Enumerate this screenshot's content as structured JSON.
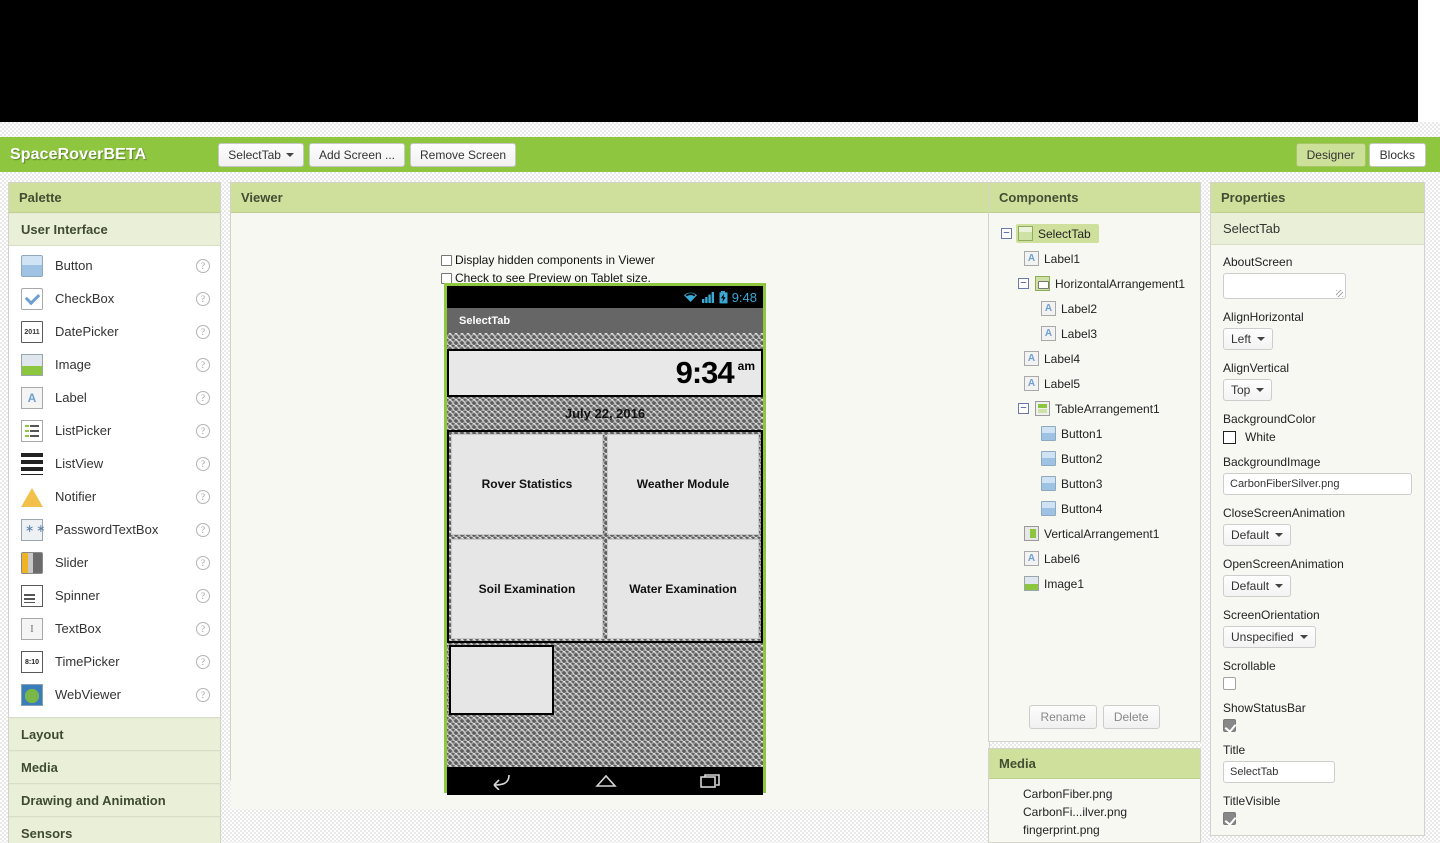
{
  "header": {
    "project_title": "SpaceRoverBETA",
    "buttons": [
      {
        "label": "SelectTab",
        "has_caret": true
      },
      {
        "label": "Add Screen ...",
        "has_caret": false
      },
      {
        "label": "Remove Screen",
        "has_caret": false
      }
    ],
    "designer_tab": "Designer",
    "blocks_tab": "Blocks"
  },
  "palette": {
    "title": "Palette",
    "groups": [
      {
        "name": "User Interface",
        "expanded": true,
        "items": [
          {
            "label": "Button",
            "icon": "button-icon"
          },
          {
            "label": "CheckBox",
            "icon": "checkbox-icon"
          },
          {
            "label": "DatePicker",
            "icon": "datepicker-icon"
          },
          {
            "label": "Image",
            "icon": "image-icon"
          },
          {
            "label": "Label",
            "icon": "label-icon"
          },
          {
            "label": "ListPicker",
            "icon": "listpicker-icon"
          },
          {
            "label": "ListView",
            "icon": "listview-icon"
          },
          {
            "label": "Notifier",
            "icon": "notifier-icon"
          },
          {
            "label": "PasswordTextBox",
            "icon": "password-icon"
          },
          {
            "label": "Slider",
            "icon": "slider-icon"
          },
          {
            "label": "Spinner",
            "icon": "spinner-icon"
          },
          {
            "label": "TextBox",
            "icon": "textbox-icon"
          },
          {
            "label": "TimePicker",
            "icon": "timepicker-icon"
          },
          {
            "label": "WebViewer",
            "icon": "webviewer-icon"
          }
        ]
      },
      {
        "name": "Layout",
        "expanded": false,
        "items": []
      },
      {
        "name": "Media",
        "expanded": false,
        "items": []
      },
      {
        "name": "Drawing and Animation",
        "expanded": false,
        "items": []
      },
      {
        "name": "Sensors",
        "expanded": false,
        "items": []
      }
    ],
    "help_glyph": "?",
    "icon_text": {
      "datepicker": "2011",
      "label": "A",
      "textbox": "I",
      "timepicker": "8:10"
    }
  },
  "viewer": {
    "title": "Viewer",
    "checkbox_hidden_components": "Display hidden components in Viewer",
    "checkbox_tablet_preview": "Check to see Preview on Tablet size.",
    "phone": {
      "status_time": "9:48",
      "title_bar": "SelectTab",
      "clock_time": "9:34",
      "clock_ampm": "am",
      "date_label": "July 22, 2016",
      "buttons": [
        "Rover Statistics",
        "Weather Module",
        "Soil Examination",
        "Water Examination"
      ],
      "nav_icons": [
        "back-icon",
        "home-icon",
        "recents-icon"
      ]
    }
  },
  "components": {
    "title": "Components",
    "tree": [
      {
        "label": "SelectTab",
        "depth": 0,
        "icon": "screen-icon",
        "toggle": "minus",
        "selected": true
      },
      {
        "label": "Label1",
        "depth": 1,
        "icon": "label-icon",
        "toggle": "none",
        "selected": false
      },
      {
        "label": "HorizontalArrangement1",
        "depth": 1,
        "icon": "horizontal-arrangement-icon",
        "toggle": "minus",
        "selected": false
      },
      {
        "label": "Label2",
        "depth": 2,
        "icon": "label-icon",
        "toggle": "none",
        "selected": false
      },
      {
        "label": "Label3",
        "depth": 2,
        "icon": "label-icon",
        "toggle": "none",
        "selected": false
      },
      {
        "label": "Label4",
        "depth": 1,
        "icon": "label-icon",
        "toggle": "none",
        "selected": false
      },
      {
        "label": "Label5",
        "depth": 1,
        "icon": "label-icon",
        "toggle": "none",
        "selected": false
      },
      {
        "label": "TableArrangement1",
        "depth": 1,
        "icon": "table-arrangement-icon",
        "toggle": "minus",
        "selected": false
      },
      {
        "label": "Button1",
        "depth": 2,
        "icon": "button-icon",
        "toggle": "none",
        "selected": false
      },
      {
        "label": "Button2",
        "depth": 2,
        "icon": "button-icon",
        "toggle": "none",
        "selected": false
      },
      {
        "label": "Button3",
        "depth": 2,
        "icon": "button-icon",
        "toggle": "none",
        "selected": false
      },
      {
        "label": "Button4",
        "depth": 2,
        "icon": "button-icon",
        "toggle": "none",
        "selected": false
      },
      {
        "label": "VerticalArrangement1",
        "depth": 1,
        "icon": "vertical-arrangement-icon",
        "toggle": "none",
        "selected": false
      },
      {
        "label": "Label6",
        "depth": 1,
        "icon": "label-icon",
        "toggle": "none",
        "selected": false
      },
      {
        "label": "Image1",
        "depth": 1,
        "icon": "image-icon",
        "toggle": "none",
        "selected": false
      }
    ],
    "rename_label": "Rename",
    "delete_label": "Delete",
    "toggle_glyph": "−"
  },
  "media": {
    "title": "Media",
    "files": [
      "CarbonFiber.png",
      "CarbonFi...ilver.png",
      "fingerprint.png"
    ]
  },
  "properties": {
    "title": "Properties",
    "selected_component": "SelectTab",
    "fields": [
      {
        "name": "AboutScreen",
        "type": "textarea",
        "value": ""
      },
      {
        "name": "AlignHorizontal",
        "type": "select",
        "value": "Left"
      },
      {
        "name": "AlignVertical",
        "type": "select",
        "value": "Top"
      },
      {
        "name": "BackgroundColor",
        "type": "color",
        "value": "White",
        "swatch": "#ffffff"
      },
      {
        "name": "BackgroundImage",
        "type": "text",
        "value": "CarbonFiberSilver.png"
      },
      {
        "name": "CloseScreenAnimation",
        "type": "select",
        "value": "Default"
      },
      {
        "name": "OpenScreenAnimation",
        "type": "select",
        "value": "Default"
      },
      {
        "name": "ScreenOrientation",
        "type": "select",
        "value": "Unspecified"
      },
      {
        "name": "Scrollable",
        "type": "checkbox",
        "checked": false
      },
      {
        "name": "ShowStatusBar",
        "type": "checkbox",
        "checked": true
      },
      {
        "name": "Title",
        "type": "text",
        "value": "SelectTab"
      },
      {
        "name": "TitleVisible",
        "type": "checkbox",
        "checked": true
      }
    ]
  },
  "colors": {
    "brand_green": "#8ec63f",
    "panel_header_green": "#cfe09c",
    "group_header_green": "#eaf0d8",
    "panel_bg": "#f7f8f2",
    "status_blue": "#3aa9d6"
  }
}
